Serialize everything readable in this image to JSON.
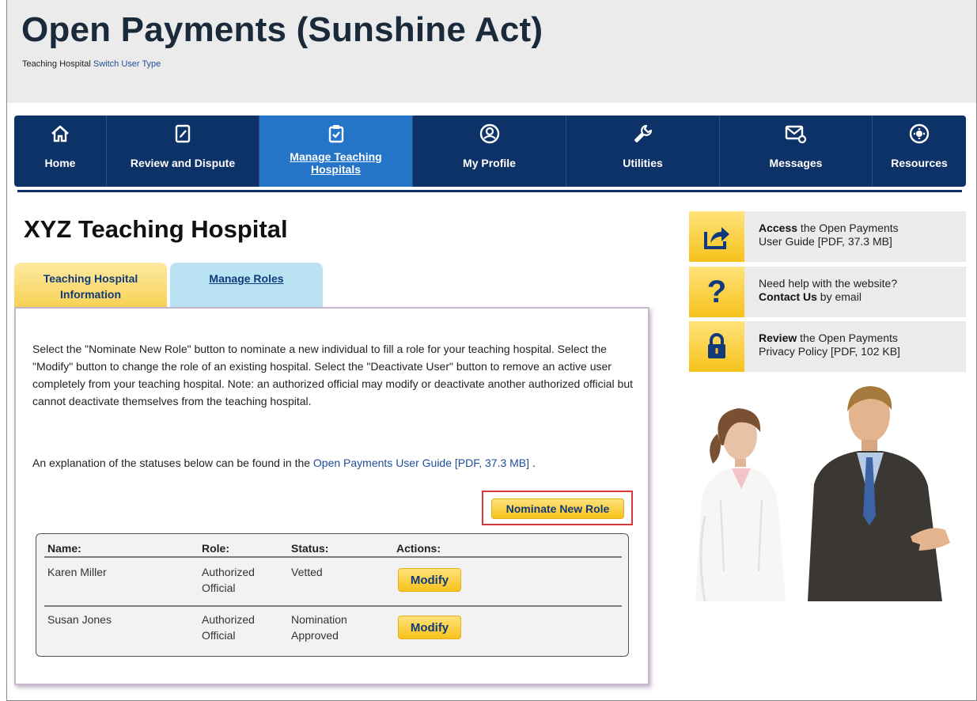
{
  "header": {
    "title": "Open Payments (Sunshine Act)",
    "user_type": "Teaching Hospital",
    "switch_link": "Switch User Type"
  },
  "nav": {
    "items": [
      {
        "label": "Home",
        "icon": "home-icon"
      },
      {
        "label": "Review and Dispute",
        "icon": "edit-document-icon"
      },
      {
        "label": "Manage Teaching Hospitals",
        "icon": "clipboard-check-icon",
        "active": true
      },
      {
        "label": "My Profile",
        "icon": "user-profile-icon"
      },
      {
        "label": "Utilities",
        "icon": "wrench-icon"
      },
      {
        "label": "Messages",
        "icon": "envelope-icon"
      },
      {
        "label": "Resources",
        "icon": "gear-icon"
      }
    ],
    "manage_line1": "Manage Teaching",
    "manage_line2": "Hospitals"
  },
  "page": {
    "hospital_name": "XYZ Teaching Hospital",
    "tabs": {
      "info_line1": "Teaching Hospital",
      "info_line2": "Information",
      "roles": "Manage Roles"
    },
    "instructions": "Select the \"Nominate New Role\" button to nominate a new individual to fill a role for your teaching hospital. Select the \"Modify\" button to change the role of an existing hospital. Select the \"Deactivate User\" button to remove an active user completely from your teaching hospital. Note: an authorized official may modify or deactivate another authorized official but cannot deactivate themselves from the teaching hospital.",
    "explanation_prefix": "An explanation of the statuses below can be found in the",
    "explanation_link": "Open Payments User Guide [PDF, 37.3 MB]",
    "explanation_suffix": ".",
    "nominate_button": "Nominate New Role"
  },
  "table": {
    "headers": {
      "name": "Name:",
      "role": "Role:",
      "status": "Status:",
      "actions": "Actions:"
    },
    "rows": [
      {
        "name": "Karen Miller",
        "role_line1": "Authorized",
        "role_line2": "Official",
        "status_line1": "Vetted",
        "status_line2": "",
        "action": "Modify"
      },
      {
        "name": "Susan Jones",
        "role_line1": "Authorized",
        "role_line2": "Official",
        "status_line1": "Nomination",
        "status_line2": "Approved",
        "action": "Modify"
      }
    ]
  },
  "sidebar": {
    "guide": {
      "bold": "Access",
      "text1": " the Open Payments",
      "text2": "User Guide [PDF, 37.3 MB]",
      "icon": "share-arrow-icon"
    },
    "help": {
      "text1": "Need help with the website?",
      "bold": "Contact Us",
      "text2": " by email",
      "icon": "question-mark-icon"
    },
    "privacy": {
      "bold": "Review",
      "text1": " the Open Payments",
      "text2": "Privacy Policy [PDF, 102 KB]",
      "icon": "lock-icon"
    }
  },
  "colors": {
    "nav_bg": "#0d3268",
    "nav_active": "#2474c7",
    "accent_yellow": "#f6c21b",
    "link": "#1f4e9a",
    "highlight_red": "#d9383a"
  }
}
